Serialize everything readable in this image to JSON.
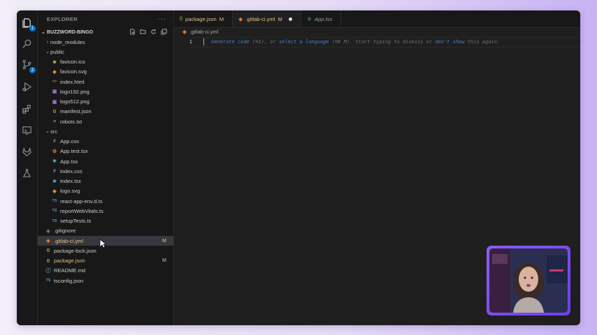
{
  "sidebar": {
    "title": "EXPLORER",
    "project_name": "BUZZWORD-BINGO",
    "tree": [
      {
        "label": "node_modules",
        "kind": "folder",
        "depth": 1,
        "expanded": false
      },
      {
        "label": "public",
        "kind": "folder",
        "depth": 1,
        "expanded": true
      },
      {
        "label": "favicon.ico",
        "kind": "file",
        "icon": "star",
        "depth": 2
      },
      {
        "label": "favicon.svg",
        "kind": "file",
        "icon": "svg",
        "depth": 2
      },
      {
        "label": "index.html",
        "kind": "file",
        "icon": "html",
        "depth": 2
      },
      {
        "label": "logo192.png",
        "kind": "file",
        "icon": "image",
        "depth": 2
      },
      {
        "label": "logo512.png",
        "kind": "file",
        "icon": "image",
        "depth": 2
      },
      {
        "label": "manifest.json",
        "kind": "file",
        "icon": "json",
        "depth": 2
      },
      {
        "label": "robots.txt",
        "kind": "file",
        "icon": "text",
        "depth": 2
      },
      {
        "label": "src",
        "kind": "folder",
        "depth": 1,
        "expanded": true
      },
      {
        "label": "App.css",
        "kind": "file",
        "icon": "css",
        "depth": 2
      },
      {
        "label": "App.test.tsx",
        "kind": "file",
        "icon": "test",
        "depth": 2
      },
      {
        "label": "App.tsx",
        "kind": "file",
        "icon": "react",
        "depth": 2
      },
      {
        "label": "index.css",
        "kind": "file",
        "icon": "css",
        "depth": 2
      },
      {
        "label": "index.tsx",
        "kind": "file",
        "icon": "react",
        "depth": 2
      },
      {
        "label": "logo.svg",
        "kind": "file",
        "icon": "svg",
        "depth": 2
      },
      {
        "label": "react-app-env.d.ts",
        "kind": "file",
        "icon": "ts",
        "depth": 2
      },
      {
        "label": "reportWebVitals.ts",
        "kind": "file",
        "icon": "ts",
        "depth": 2
      },
      {
        "label": "setupTests.ts",
        "kind": "file",
        "icon": "ts",
        "depth": 2
      },
      {
        "label": ".gitignore",
        "kind": "file",
        "icon": "git",
        "depth": 1
      },
      {
        "label": ".gitlab-ci.yml",
        "kind": "file",
        "icon": "gitlab",
        "depth": 1,
        "modified": "M",
        "selected": true
      },
      {
        "label": "package-lock.json",
        "kind": "file",
        "icon": "json",
        "depth": 1
      },
      {
        "label": "package.json",
        "kind": "file",
        "icon": "json",
        "depth": 1,
        "modified": "M"
      },
      {
        "label": "README.md",
        "kind": "file",
        "icon": "info",
        "depth": 1
      },
      {
        "label": "tsconfig.json",
        "kind": "file",
        "icon": "tsconfig",
        "depth": 1
      }
    ]
  },
  "tabs": [
    {
      "label": "package.json",
      "status": "M",
      "icon": "json",
      "active": false
    },
    {
      "label": ".gitlab-ci.yml",
      "status": "M",
      "icon": "gitlab",
      "active": true,
      "dirty": true
    },
    {
      "label": "App.tsx",
      "icon": "react",
      "active": false,
      "preview": true
    }
  ],
  "editor": {
    "breadcrumb": ".gitlab-ci.yml",
    "line_number": "1",
    "hint": {
      "part1": "Generate code",
      "part2": " (⌘I), or ",
      "part3": "select a language",
      "part4": " (⌘K M). Start typing to dismiss or ",
      "part5": "don't show",
      "part6": " this again."
    }
  },
  "colors": {
    "modified": "#e2c08d",
    "accent": "#0078d4",
    "webcam_frame": "#8c5cf6",
    "gitlab_orange": "#e2703a",
    "react_blue": "#58c4dc",
    "ts_blue": "#519aba",
    "json_yellow": "#cbcb41"
  },
  "activity_bar": [
    {
      "name": "explorer-icon",
      "badge": "1"
    },
    {
      "name": "search-icon"
    },
    {
      "name": "source-control-icon",
      "badge": "2"
    },
    {
      "name": "run-debug-icon"
    },
    {
      "name": "extensions-icon"
    },
    {
      "name": "remote-explorer-icon"
    },
    {
      "name": "gitlab-icon"
    },
    {
      "name": "testing-icon"
    }
  ]
}
